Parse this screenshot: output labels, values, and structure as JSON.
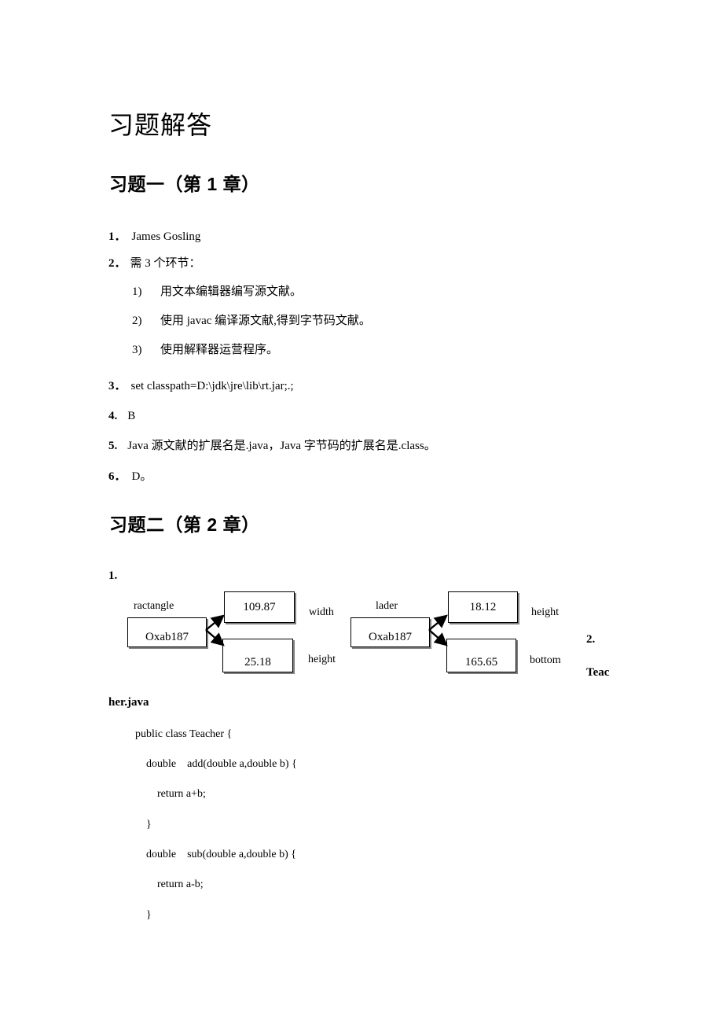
{
  "document": {
    "title": "习题解答",
    "sections": [
      {
        "heading": "习题一（第 1 章）"
      },
      {
        "heading": "习题二（第 2 章）"
      }
    ]
  },
  "section1": {
    "items": [
      {
        "num": "1．",
        "text": "James Gosling"
      },
      {
        "num": "2．",
        "text": "需 3 个环节："
      },
      {
        "num": "3．",
        "text": "set classpath=D:\\jdk\\jre\\lib\\rt.jar;.;"
      },
      {
        "num": "4.",
        "text": "B"
      },
      {
        "num": "5.",
        "text": "Java 源文献的扩展名是.java，Java 字节码的扩展名是.class。"
      },
      {
        "num": "6．",
        "text": "D。"
      }
    ],
    "subitems": [
      {
        "num": "1)",
        "text": "用文本编辑器编写源文献。"
      },
      {
        "num": "2)",
        "text": "使用 javac 编译源文献,得到字节码文献。"
      },
      {
        "num": "3)",
        "text": "使用解释器运营程序。"
      }
    ]
  },
  "section2": {
    "item1_num": "1.",
    "item2_num": "2.",
    "filename_head": "Teac",
    "filename_tail": "her.java",
    "diagrams": [
      {
        "name": "ractangle",
        "ref_value": "Oxab187",
        "fields": [
          {
            "value": "109.87",
            "label": "width"
          },
          {
            "value": "25.18",
            "label": "height"
          }
        ]
      },
      {
        "name": "lader",
        "ref_value": "Oxab187",
        "fields": [
          {
            "value": "18.12",
            "label": "height"
          },
          {
            "value": "165.65",
            "label": "bottom"
          }
        ]
      }
    ],
    "code_lines": [
      "public class Teacher {",
      "    double    add(double a,double b) {",
      "        return a+b;",
      "    }",
      "    double    sub(double a,double b) {",
      "        return a-b;",
      "    }"
    ]
  },
  "colors": {
    "text": "#000000",
    "page_background": "#ffffff",
    "box_border": "#000000",
    "box_shadow": "#808080"
  }
}
